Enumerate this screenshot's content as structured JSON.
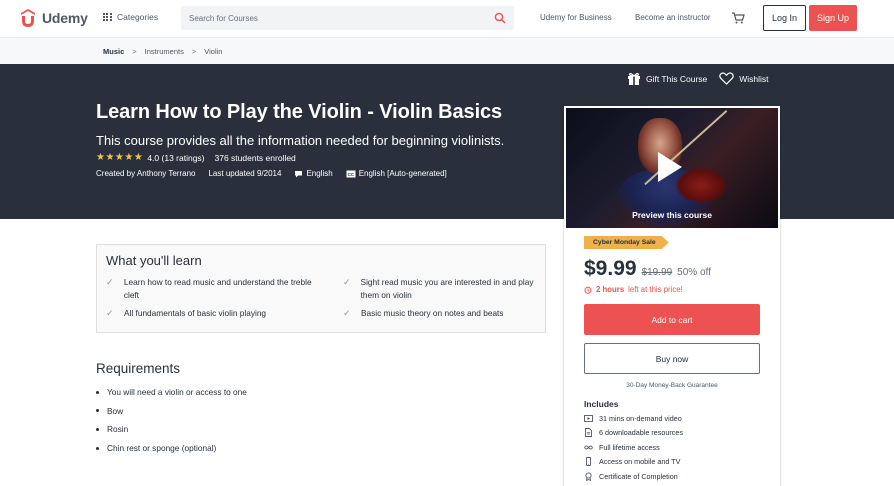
{
  "brand": {
    "name": "Udemy",
    "color": "#ec5252"
  },
  "nav": {
    "categories_label": "Categories",
    "search_placeholder": "Search for Courses",
    "business_link": "Udemy for Business",
    "instructor_link": "Become an instructor",
    "login_label": "Log In",
    "signup_label": "Sign Up"
  },
  "breadcrumb": [
    "Music",
    "Instruments",
    "Violin"
  ],
  "hero": {
    "gift_label": "Gift This Course",
    "wishlist_label": "Wishlist",
    "title": "Learn How to Play the Violin - Violin Basics",
    "subtitle": "This course provides all the information needed for beginning violinists.",
    "rating_stars": 4.0,
    "rating_text": "4.0 (13 ratings)",
    "students": "376 students enrolled",
    "created_by": "Created by Anthony Terrano",
    "last_updated": "Last updated 9/2014",
    "language": "English",
    "captions": "English [Auto-generated]"
  },
  "card": {
    "preview_label": "Preview this course",
    "sale_badge": "Cyber Monday Sale",
    "price": "$9.99",
    "original_price": "$19.99",
    "discount": "50% off",
    "timer_bold": "2 hours",
    "timer_rest": "left at this price!",
    "add_to_cart": "Add to cart",
    "buy_now": "Buy now",
    "guarantee": "30-Day Money-Back Guarantee",
    "includes_title": "Includes",
    "includes": [
      {
        "icon": "video-icon",
        "text": "31 mins on-demand video"
      },
      {
        "icon": "file-icon",
        "text": "6 downloadable resources"
      },
      {
        "icon": "infinity-icon",
        "text": "Full lifetime access"
      },
      {
        "icon": "mobile-icon",
        "text": "Access on mobile and TV"
      },
      {
        "icon": "certificate-icon",
        "text": "Certificate of Completion"
      }
    ]
  },
  "learn": {
    "title": "What you'll learn",
    "items": [
      "Learn how to read music and understand the treble cleft",
      "Sight read music you are interested in and play them on violin",
      "All fundamentals of basic violin playing",
      "Basic music theory on notes and beats"
    ]
  },
  "requirements": {
    "title": "Requirements",
    "items": [
      "You will need a violin or access to one",
      "Bow",
      "Rosin",
      "Chin rest or sponge (optional)"
    ]
  }
}
